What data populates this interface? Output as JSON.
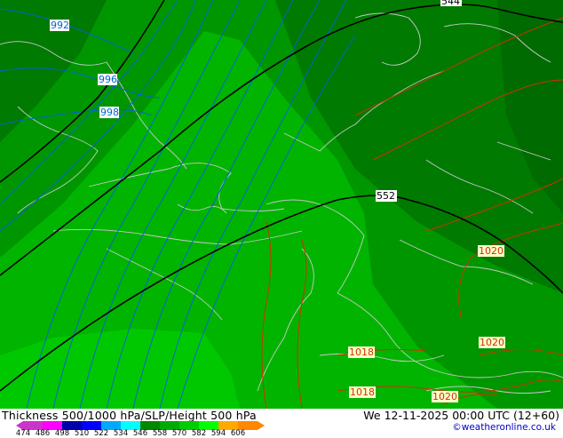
{
  "map": {
    "pressure_labels_blue": [
      "992",
      "996",
      "998"
    ],
    "pressure_labels_red": [
      "1020",
      "1020",
      "1018",
      "1018",
      "1020"
    ],
    "height_labels_black": [
      "552",
      "544"
    ],
    "colors": {
      "green_dark": "#007a00",
      "green_mid": "#009600",
      "green_light": "#00b400",
      "green_bright": "#00c800",
      "slp_line": "#cc3300",
      "low_line": "#0066cc",
      "height_line": "#000000",
      "coast": "#c8c8c8"
    }
  },
  "footer": {
    "title": "Thickness 500/1000 hPa/SLP/Height 500 hPa",
    "datetime": "We 12-11-2025 00:00 UTC (12+60)",
    "credit": "©weatheronline.co.uk",
    "scale_ticks": [
      "474",
      "486",
      "498",
      "510",
      "522",
      "534",
      "546",
      "558",
      "570",
      "582",
      "594",
      "606"
    ],
    "scale_colors": [
      "#cc33cc",
      "#ff00ff",
      "#0000aa",
      "#0000ff",
      "#00aaff",
      "#00ffff",
      "#008800",
      "#00aa00",
      "#00cc00",
      "#00ff00",
      "#ffaa00",
      "#ff8800"
    ]
  }
}
